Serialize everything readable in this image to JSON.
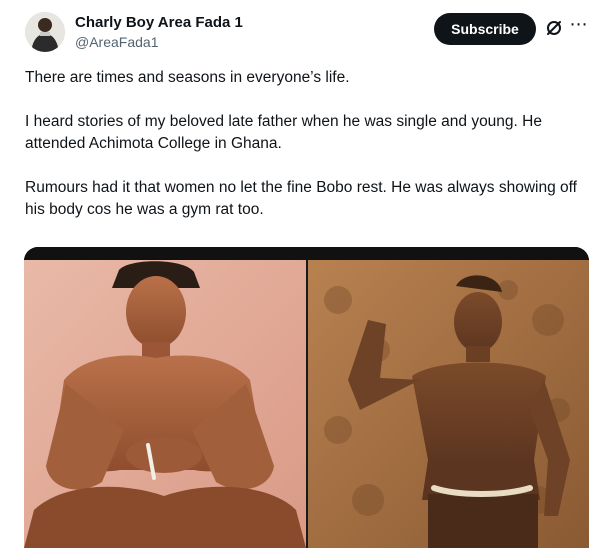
{
  "post": {
    "author": {
      "display_name": "Charly Boy Area Fada 1",
      "handle": "@AreaFada1"
    },
    "subscribe_label": "Subscribe",
    "more_icon": "more-options-icon",
    "grok_icon": "grok-icon",
    "paragraphs": [
      "There are times and seasons in everyone’s life.",
      "I heard stories of my beloved late father when he was single and young. He attended Achimota College in Ghana.",
      "Rumours had it that women no let the fine Bobo rest. He was always showing off his body cos he was a gym rat too."
    ],
    "media": {
      "count": 2
    }
  },
  "colors": {
    "subscribe_bg": "#0f1419",
    "text": "#0f1419",
    "secondary_text": "#536471"
  }
}
